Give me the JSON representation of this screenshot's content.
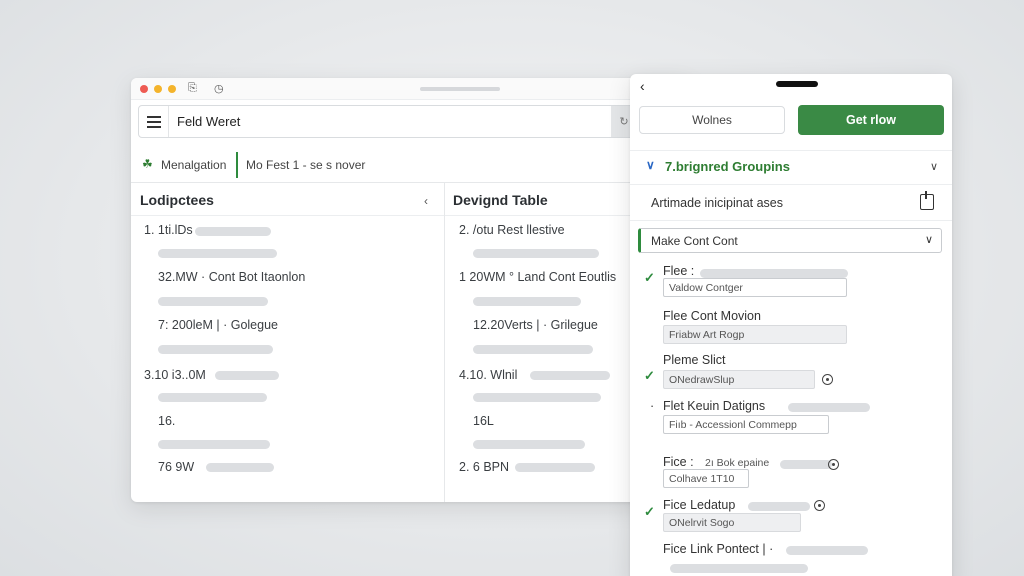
{
  "window": {
    "toolbar": {
      "field_value": "Feld Weret"
    },
    "nav": {
      "item1": "Menalgation",
      "item2": "Mo Fest  1  - se s nover"
    },
    "columns": [
      {
        "title": "Lodipctees",
        "rows": [
          "1. 1ti.lDs",
          "32.MW  · Cont Bot Itaonlon",
          "7: 200leM  |  · Golegue",
          "3.10  i3..0M",
          "16.",
          "76  9W"
        ]
      },
      {
        "title": "Devignd Table",
        "rows": [
          "2.  /otu Rest llestive",
          "1  20WM  ° Land Cont Eoutlis",
          "12.20Verts  |  · Grilegue",
          "4.10.  Wlnil",
          "16L",
          "2.  6 BPN"
        ]
      }
    ]
  },
  "panel": {
    "btn_secondary": "Wolnes",
    "btn_primary": "Get rlow",
    "group_title": "7.brignred Groupins",
    "subheading": "Artimade inicipinat ases",
    "select_value": "Make Cont Cont",
    "fields": [
      {
        "label": "Flee  :",
        "value": "Valdow Contger"
      },
      {
        "label": "Flee Cont Movion",
        "value": "Friabw Art Rogp"
      },
      {
        "label": "Pleme Slict",
        "value": "ONedrawSlup"
      },
      {
        "label": "Flet Keuin Datigns",
        "value": "Fiıb  -  Accessionl Commepp"
      },
      {
        "label": "Fice  :",
        "inline": "2ı  Bok  epaine",
        "value": "Colhave  1T10"
      },
      {
        "label": "Fice Ledatup",
        "value": "ONelrvit Sogo"
      },
      {
        "label": "Fice  Link Pontect  |  ·"
      }
    ]
  },
  "colors": {
    "accent_green": "#3a8a45",
    "check_green": "#2e8b3e",
    "chevron_blue": "#2a67c4"
  }
}
